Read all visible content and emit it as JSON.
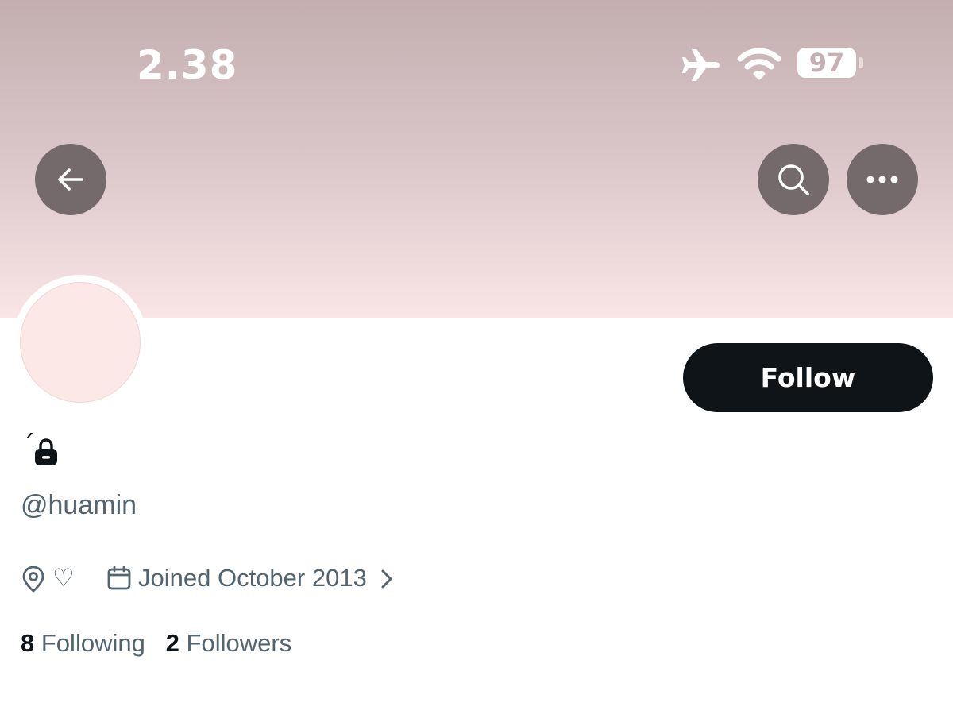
{
  "status_bar": {
    "time": "2.38",
    "battery": "97"
  },
  "profile": {
    "display_name": "´",
    "handle": "@huamin",
    "location": "♡",
    "joined": "Joined October 2013",
    "following_count": "8",
    "following_label": "Following",
    "followers_count": "2",
    "followers_label": "Followers"
  },
  "actions": {
    "follow_label": "Follow"
  },
  "icons": {
    "back": "arrow-left-icon",
    "search": "search-icon",
    "more": "more-dots-icon",
    "lock": "lock-icon",
    "location": "location-pin-icon",
    "calendar": "calendar-icon",
    "chevron": "chevron-right-icon",
    "airplane": "airplane-icon",
    "wifi": "wifi-icon",
    "battery": "battery-icon"
  },
  "colors": {
    "banner_top": "#c3aeb0",
    "banner_bottom": "#f9e5e6",
    "avatar_fill": "#fde8e8",
    "follow_button": "#0f1419",
    "secondary_text": "#536471",
    "round_button": "#756a6b"
  }
}
